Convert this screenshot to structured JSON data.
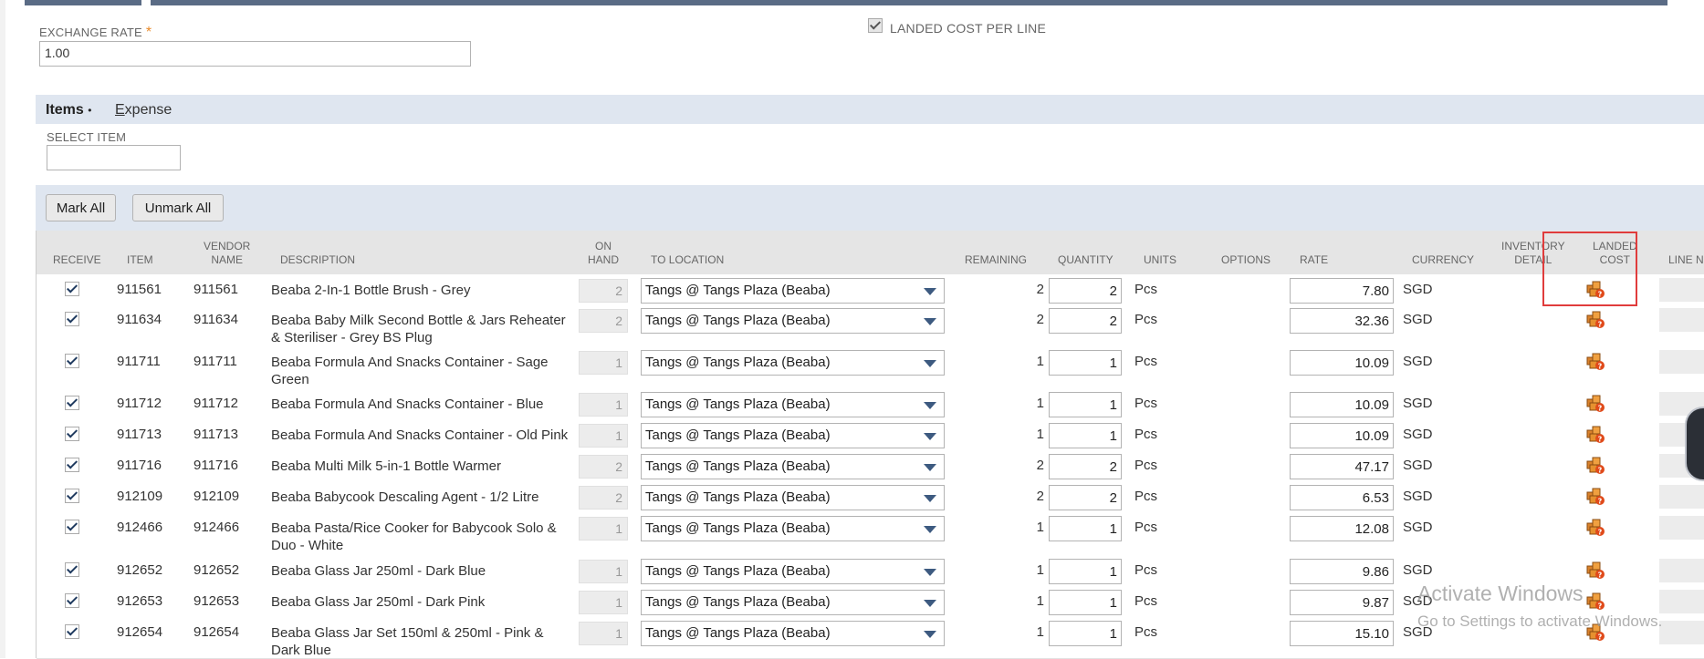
{
  "header": {
    "exchange_rate_label": "EXCHANGE RATE",
    "required_mark": "*",
    "exchange_rate_value": "1.00",
    "landed_cost_per_line_label": "LANDED COST PER LINE"
  },
  "tabs": {
    "items_label": "Items",
    "items_dot": "•",
    "expense_prefix": "E",
    "expense_rest": "xpense"
  },
  "select_item": {
    "label": "SELECT ITEM",
    "value": ""
  },
  "buttons": {
    "mark_all": "Mark All",
    "unmark_all": "Unmark All"
  },
  "columns": {
    "receive": "RECEIVE",
    "item": "ITEM",
    "vendor_name_1": "VENDOR",
    "vendor_name_2": "NAME",
    "description": "DESCRIPTION",
    "on_hand_1": "ON",
    "on_hand_2": "HAND",
    "to_location": "TO LOCATION",
    "remaining": "REMAINING",
    "quantity": "QUANTITY",
    "units": "UNITS",
    "options": "OPTIONS",
    "rate": "RATE",
    "currency": "CURRENCY",
    "inventory_detail_1": "INVENTORY",
    "inventory_detail_2": "DETAIL",
    "landed_cost_1": "LANDED",
    "landed_cost_2": "COST",
    "line_partial": "LINE N"
  },
  "rows": [
    {
      "item": "911561",
      "vendor": "911561",
      "desc1": "Beaba 2-In-1 Bottle Brush - Grey",
      "desc2": "",
      "on_hand": "2",
      "location": "Tangs @ Tangs Plaza (Beaba)",
      "remaining": "2",
      "quantity": "2",
      "units": "Pcs",
      "rate": "7.80",
      "currency": "SGD"
    },
    {
      "item": "911634",
      "vendor": "911634",
      "desc1": "Beaba Baby Milk Second Bottle & Jars Reheater",
      "desc2": "& Steriliser - Grey BS Plug",
      "on_hand": "2",
      "location": "Tangs @ Tangs Plaza (Beaba)",
      "remaining": "2",
      "quantity": "2",
      "units": "Pcs",
      "rate": "32.36",
      "currency": "SGD"
    },
    {
      "item": "911711",
      "vendor": "911711",
      "desc1": "Beaba Formula And Snacks Container - Sage",
      "desc2": "Green",
      "on_hand": "1",
      "location": "Tangs @ Tangs Plaza (Beaba)",
      "remaining": "1",
      "quantity": "1",
      "units": "Pcs",
      "rate": "10.09",
      "currency": "SGD"
    },
    {
      "item": "911712",
      "vendor": "911712",
      "desc1": "Beaba Formula And Snacks Container - Blue",
      "desc2": "",
      "on_hand": "1",
      "location": "Tangs @ Tangs Plaza (Beaba)",
      "remaining": "1",
      "quantity": "1",
      "units": "Pcs",
      "rate": "10.09",
      "currency": "SGD"
    },
    {
      "item": "911713",
      "vendor": "911713",
      "desc1": "Beaba Formula And Snacks Container - Old Pink",
      "desc2": "",
      "on_hand": "1",
      "location": "Tangs @ Tangs Plaza (Beaba)",
      "remaining": "1",
      "quantity": "1",
      "units": "Pcs",
      "rate": "10.09",
      "currency": "SGD"
    },
    {
      "item": "911716",
      "vendor": "911716",
      "desc1": "Beaba Multi Milk 5-in-1 Bottle Warmer",
      "desc2": "",
      "on_hand": "2",
      "location": "Tangs @ Tangs Plaza (Beaba)",
      "remaining": "2",
      "quantity": "2",
      "units": "Pcs",
      "rate": "47.17",
      "currency": "SGD"
    },
    {
      "item": "912109",
      "vendor": "912109",
      "desc1": "Beaba Babycook Descaling Agent - 1/2 Litre",
      "desc2": "",
      "on_hand": "2",
      "location": "Tangs @ Tangs Plaza (Beaba)",
      "remaining": "2",
      "quantity": "2",
      "units": "Pcs",
      "rate": "6.53",
      "currency": "SGD"
    },
    {
      "item": "912466",
      "vendor": "912466",
      "desc1": "Beaba Pasta/Rice Cooker for Babycook Solo &",
      "desc2": "Duo - White",
      "on_hand": "1",
      "location": "Tangs @ Tangs Plaza (Beaba)",
      "remaining": "1",
      "quantity": "1",
      "units": "Pcs",
      "rate": "12.08",
      "currency": "SGD"
    },
    {
      "item": "912652",
      "vendor": "912652",
      "desc1": "Beaba Glass Jar 250ml - Dark Blue",
      "desc2": "",
      "on_hand": "1",
      "location": "Tangs @ Tangs Plaza (Beaba)",
      "remaining": "1",
      "quantity": "1",
      "units": "Pcs",
      "rate": "9.86",
      "currency": "SGD"
    },
    {
      "item": "912653",
      "vendor": "912653",
      "desc1": "Beaba Glass Jar 250ml - Dark Pink",
      "desc2": "",
      "on_hand": "1",
      "location": "Tangs @ Tangs Plaza (Beaba)",
      "remaining": "1",
      "quantity": "1",
      "units": "Pcs",
      "rate": "9.87",
      "currency": "SGD"
    },
    {
      "item": "912654",
      "vendor": "912654",
      "desc1": "Beaba Glass Jar Set 150ml & 250ml - Pink &",
      "desc2": "Dark Blue",
      "on_hand": "1",
      "location": "Tangs @ Tangs Plaza (Beaba)",
      "remaining": "1",
      "quantity": "1",
      "units": "Pcs",
      "rate": "15.10",
      "currency": "SGD"
    }
  ],
  "watermark": {
    "line1": "Activate Windows",
    "line2": "Go to Settings to activate Windows."
  },
  "icons": {
    "landed_cost": "landed-cost-icon",
    "dropdown": "dropdown-arrow-icon",
    "checkbox": "checkbox-checked-icon"
  },
  "colors": {
    "accent": "#5a6b85",
    "tab_bar": "#dfe6f0",
    "highlight": "#e03c3c",
    "icon_orange": "#e07b1f"
  }
}
